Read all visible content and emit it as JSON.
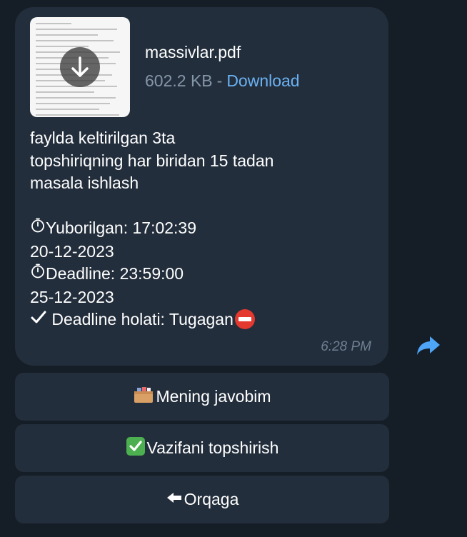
{
  "message": {
    "file": {
      "name": "massivlar.pdf",
      "size": "602.2 KB",
      "separator": "-",
      "download_label": "Download"
    },
    "lines": [
      "faylda keltirilgan 3ta",
      "topshiriqning har biridan 15 tadan",
      "masala ishlash",
      "",
      "Yuborilgan:  17:02:39",
      "20-12-2023",
      "Deadline:  23:59:00",
      "25-12-2023",
      "Deadline holati:  Tugagan"
    ],
    "time": "6:28 PM"
  },
  "keyboard": {
    "buttons": [
      {
        "label": "Mening javobim",
        "icon": "card-file-box-icon"
      },
      {
        "label": "Vazifani topshirish",
        "icon": "check-mark-button-icon"
      },
      {
        "label": "Orqaga",
        "icon": "left-arrow-icon"
      }
    ]
  },
  "colors": {
    "background": "#151e27",
    "bubble": "#232e3c",
    "link": "#6ab2f2",
    "muted": "#8596a7",
    "forward": "#4ea4f6"
  }
}
